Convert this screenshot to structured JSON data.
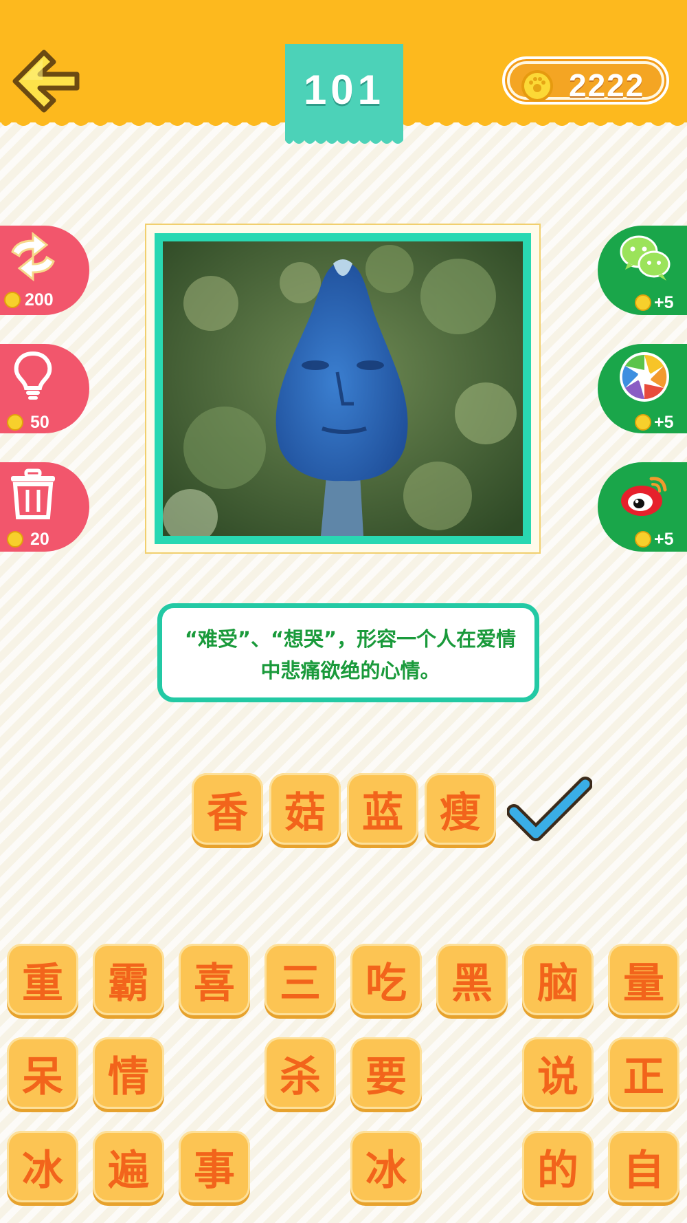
{
  "header": {
    "level": "101",
    "coins": "2222",
    "back_icon": "arrow-left-icon",
    "coin_icon": "gold-coin-icon"
  },
  "left_actions": [
    {
      "name": "refresh",
      "icon": "swap-arrows-icon",
      "cost": "200"
    },
    {
      "name": "hint",
      "icon": "lightbulb-icon",
      "cost": "50"
    },
    {
      "name": "remove",
      "icon": "trash-icon",
      "cost": "20"
    }
  ],
  "right_actions": [
    {
      "name": "wechat",
      "icon": "wechat-icon",
      "reward": "+5"
    },
    {
      "name": "moments",
      "icon": "moments-aperture-icon",
      "reward": "+5"
    },
    {
      "name": "weibo",
      "icon": "weibo-icon",
      "reward": "+5"
    }
  ],
  "puzzle": {
    "image": "blue-mushroom-face-photo",
    "hint": "“难受”、“想哭”，形容一个人在爱情中悲痛欲绝的心情。"
  },
  "answer": {
    "slots": [
      "香",
      "菇",
      "蓝",
      "瘦"
    ],
    "status_icon": "checkmark-icon"
  },
  "choices": {
    "row1": [
      "重",
      "霸",
      "喜",
      "三",
      "吃",
      "黑",
      "脑",
      "量"
    ],
    "row2": [
      "呆",
      "情",
      "",
      "杀",
      "要",
      "",
      "说",
      "正"
    ],
    "row3": [
      "冰",
      "遍",
      "事",
      "",
      "冰",
      "",
      "的",
      "自"
    ]
  },
  "colors": {
    "header": "#fdb91e",
    "level_tag": "#4cd2b8",
    "tile_bg": "#fcc453",
    "tile_text": "#f2641b",
    "left_button": "#f2566c",
    "right_button": "#1aa64a",
    "hint_border": "#23c9a4",
    "hint_text": "#1a9a3b",
    "check": "#3aaee6"
  }
}
